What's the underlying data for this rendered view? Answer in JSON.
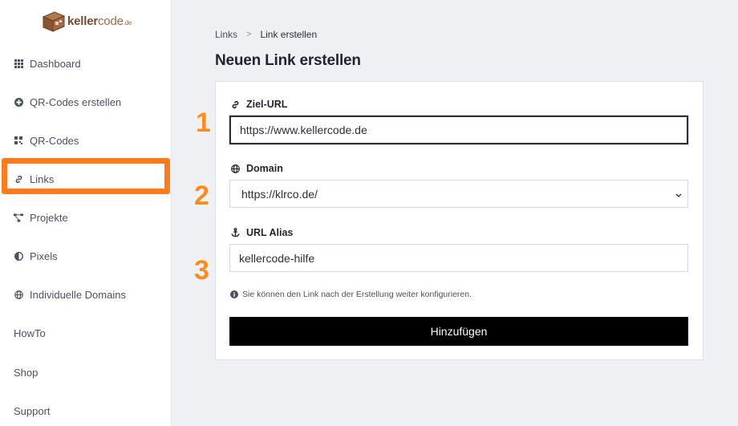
{
  "brand": {
    "logo_name": "kellercode.de",
    "logo_bold": "keller",
    "logo_light": "code",
    "logo_suffix": ".de"
  },
  "sidebar": {
    "items": [
      {
        "label": "Dashboard",
        "icon": "grid-icon"
      },
      {
        "label": "QR-Codes erstellen",
        "icon": "plus-circle-icon"
      },
      {
        "label": "QR-Codes",
        "icon": "qrcode-icon"
      },
      {
        "label": "Links",
        "icon": "link-icon",
        "highlighted": true
      },
      {
        "label": "Projekte",
        "icon": "project-diagram-icon"
      },
      {
        "label": "Pixels",
        "icon": "adjust-icon"
      },
      {
        "label": "Individuelle Domains",
        "icon": "globe-icon"
      },
      {
        "label": "HowTo"
      },
      {
        "label": "Shop"
      },
      {
        "label": "Support"
      }
    ]
  },
  "breadcrumb": {
    "parent": "Links",
    "separator": ">",
    "current": "Link erstellen"
  },
  "page": {
    "title": "Neuen Link erstellen"
  },
  "form": {
    "url_label": "Ziel-URL",
    "url_value": "https://www.kellercode.de",
    "domain_label": "Domain",
    "domain_value": "https://klrco.de/",
    "alias_label": "URL Alias",
    "alias_value": "kellercode-hilfe",
    "hint": "Sie können den Link nach der Erstellung weiter konfigurieren.",
    "submit_label": "Hinzufügen"
  },
  "annotations": {
    "step1": "1",
    "step2": "2",
    "step3": "3"
  },
  "colors": {
    "accent": "#ff7a1a",
    "button": "#000000",
    "brand": "#7a4a2a"
  }
}
